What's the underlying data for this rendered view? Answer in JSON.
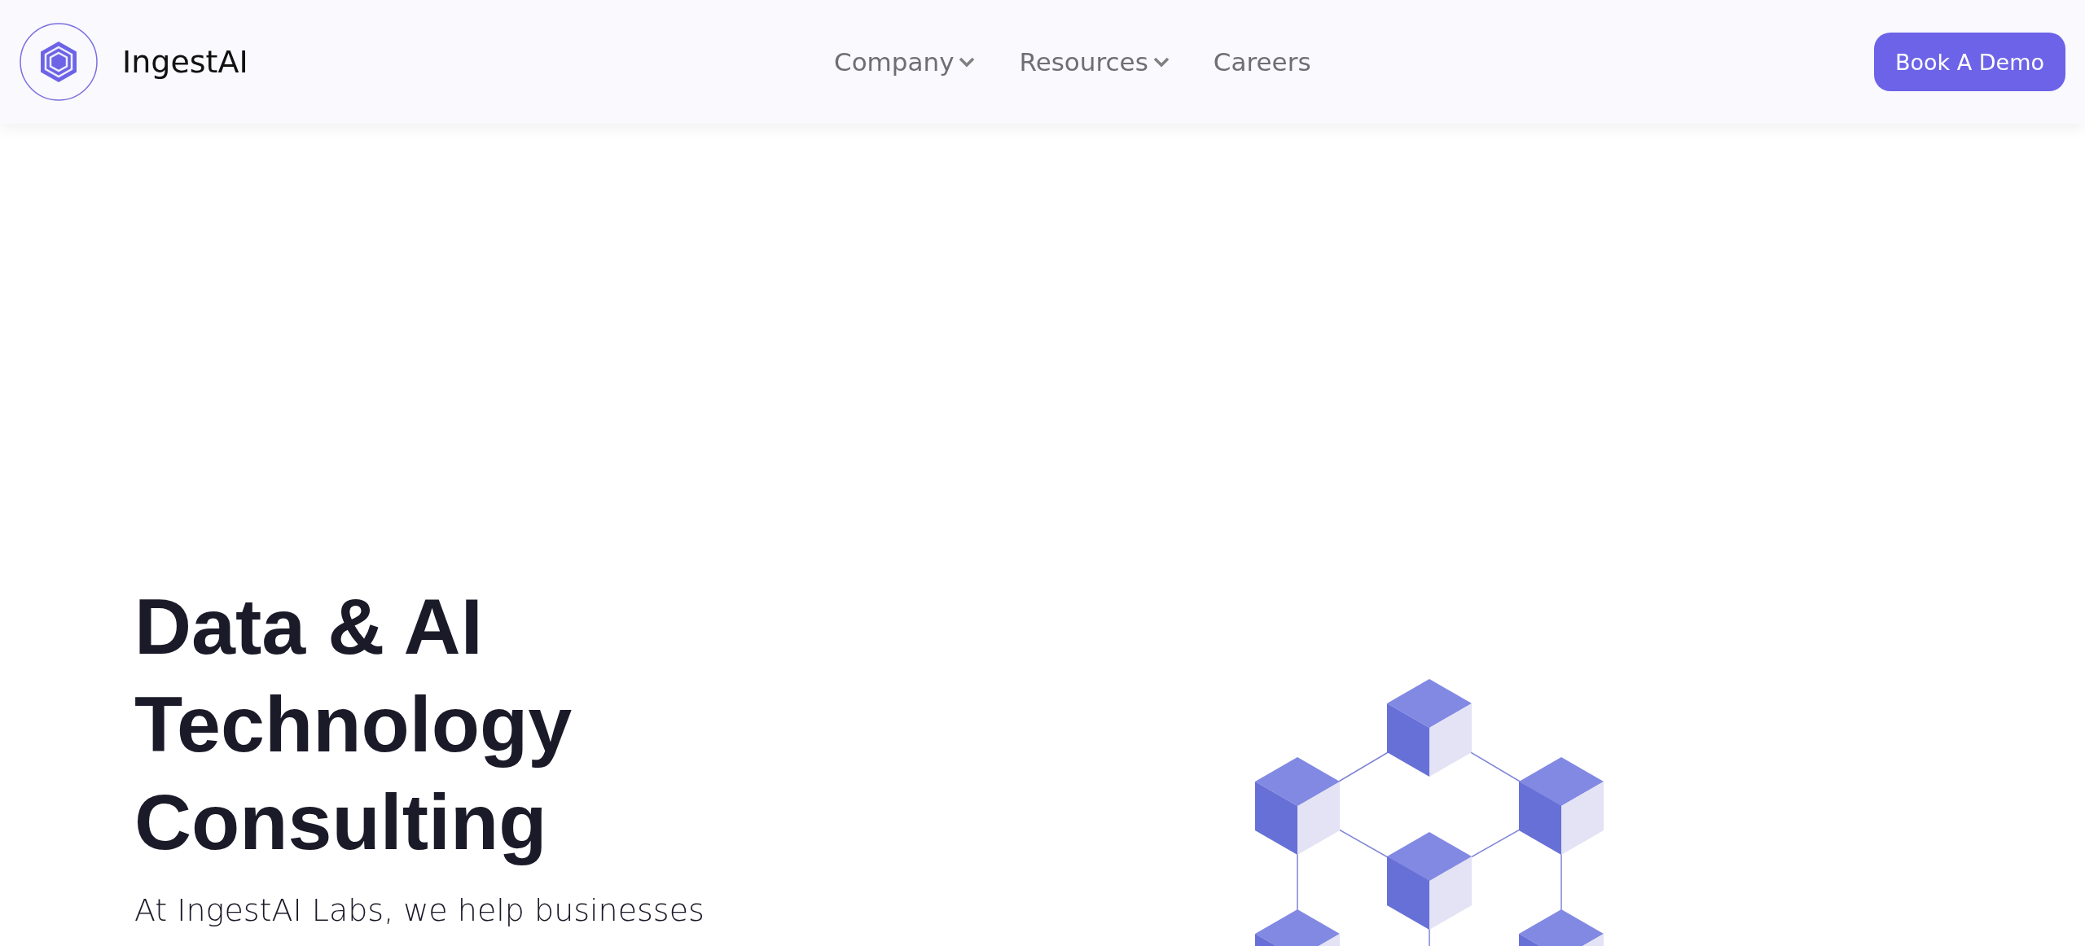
{
  "header": {
    "brand": "IngestAI",
    "nav": [
      {
        "label": "Company",
        "has_menu": true
      },
      {
        "label": "Resources",
        "has_menu": true
      },
      {
        "label": "Careers",
        "has_menu": false
      }
    ],
    "cta": "Book A Demo"
  },
  "hero": {
    "heading": "Data & AI Technology Consulting",
    "subtitle": "At IngestAI Labs, we help businesses"
  }
}
